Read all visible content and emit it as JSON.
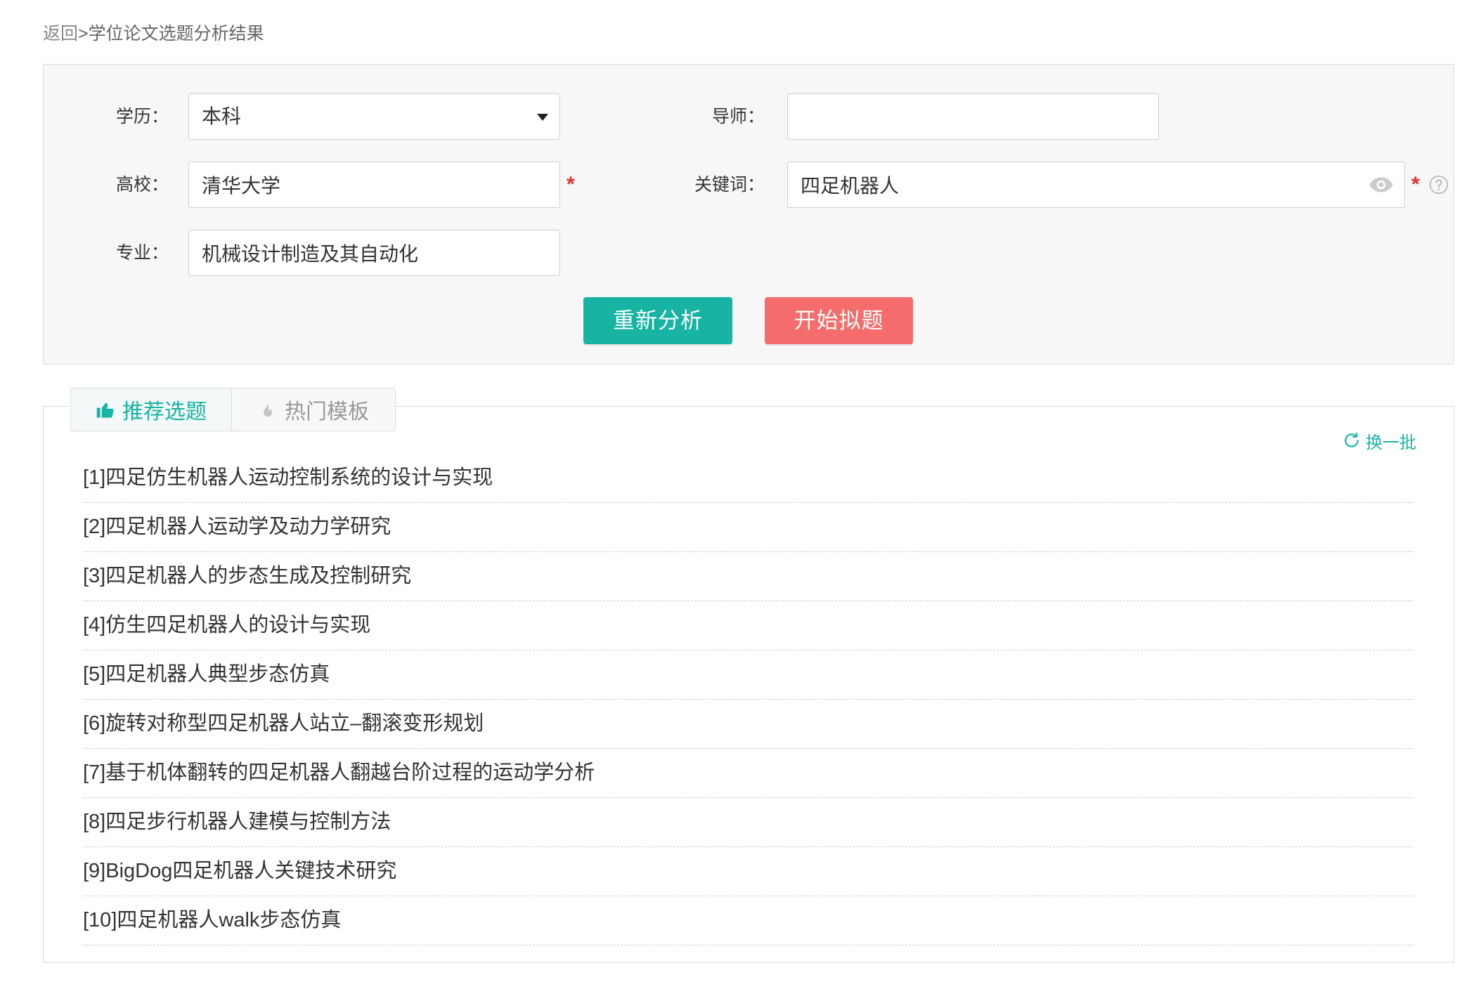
{
  "breadcrumb": {
    "back": "返回",
    "separator": ">",
    "current": "学位论文选题分析结果"
  },
  "colors": {
    "accent": "#17b3a3",
    "danger": "#f46c6c",
    "required": "#e52e2e"
  },
  "form": {
    "degree": {
      "label": "学历：",
      "value": "本科",
      "icon": "chevron-down-icon"
    },
    "advisor": {
      "label": "导师：",
      "value": ""
    },
    "university": {
      "label": "高校：",
      "value": "清华大学",
      "required": "*"
    },
    "keywords": {
      "label": "关键词：",
      "value": "四足机器人",
      "required": "*",
      "icons": [
        "eye-icon",
        "help-icon"
      ]
    },
    "major": {
      "label": "专业：",
      "value": "机械设计制造及其自动化"
    },
    "buttons": {
      "reanalyze": "重新分析",
      "start": "开始拟题"
    }
  },
  "results": {
    "tabs": [
      {
        "label": "推荐选题",
        "icon": "thumbs-up-icon",
        "active": true
      },
      {
        "label": "热门模板",
        "icon": "fire-icon",
        "active": false
      }
    ],
    "refresh": {
      "label": "换一批",
      "icon": "refresh-icon"
    },
    "topics": [
      {
        "index": "[1]",
        "title": "四足仿生机器人运动控制系统的设计与实现"
      },
      {
        "index": "[2]",
        "title": "四足机器人运动学及动力学研究"
      },
      {
        "index": "[3]",
        "title": "四足机器人的步态生成及控制研究"
      },
      {
        "index": "[4]",
        "title": "仿生四足机器人的设计与实现"
      },
      {
        "index": "[5]",
        "title": "四足机器人典型步态仿真"
      },
      {
        "index": "[6]",
        "title": "旋转对称型四足机器人站立–翻滚变形规划"
      },
      {
        "index": "[7]",
        "title": "基于机体翻转的四足机器人翻越台阶过程的运动学分析"
      },
      {
        "index": "[8]",
        "title": "四足步行机器人建模与控制方法"
      },
      {
        "index": "[9]",
        "title": "BigDog四足机器人关键技术研究"
      },
      {
        "index": "[10]",
        "title": "四足机器人walk步态仿真"
      }
    ]
  }
}
